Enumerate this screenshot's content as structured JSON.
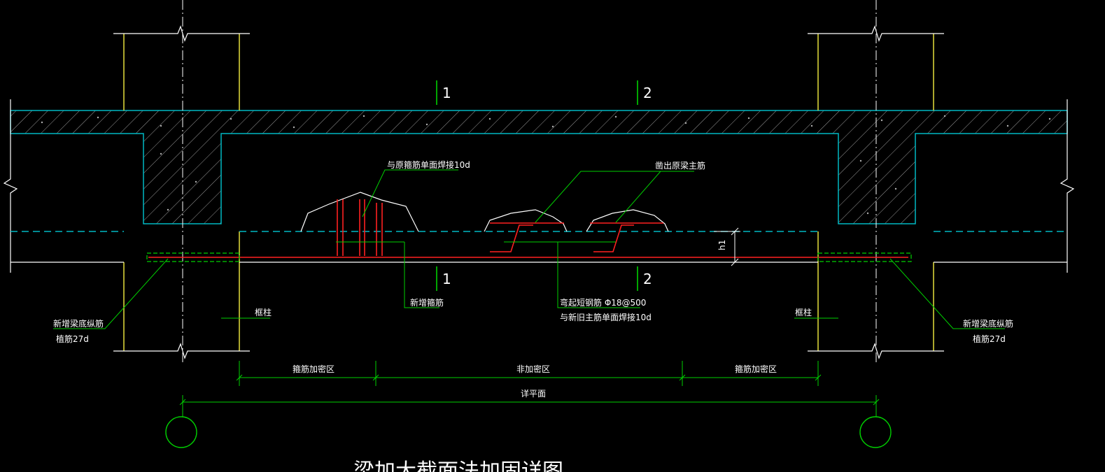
{
  "drawing": {
    "background": "#000000",
    "colors": {
      "concrete_outline": "#00b7c3",
      "column": "#e5e03c",
      "rebar": "#ff2020",
      "leader": "#00d000",
      "axis": "#ffffff",
      "hatch": "#a0a0a0",
      "grid_bubble": "#00d000"
    },
    "section_marks": [
      {
        "label": "1"
      },
      {
        "label": "2"
      },
      {
        "label": "1"
      },
      {
        "label": "2"
      }
    ],
    "annotations": {
      "weld_to_existing_stirrup": "与原箍筋单面焊接10d",
      "chip_existing_main_bar": "凿出原梁主筋",
      "new_stirrup": "新增箍筋",
      "bent_bar_line1": "弯起短钢筋 Φ18@500",
      "bent_bar_line2": "与新旧主筋单面焊接10d",
      "column_left": "框柱",
      "column_right": "框柱",
      "new_bottom_bar_left_line1": "新增梁底纵筋",
      "new_bottom_bar_left_line2": "植筋27d",
      "new_bottom_bar_right_line1": "新增梁底纵筋",
      "new_bottom_bar_right_line2": "植筋27d",
      "height_mark": "h1"
    },
    "dimensions": {
      "zone_left": "箍筋加密区",
      "zone_middle": "非加密区",
      "zone_right": "箍筋加密区",
      "overall": "详平面"
    },
    "title": "梁加大截面法加固详图"
  }
}
